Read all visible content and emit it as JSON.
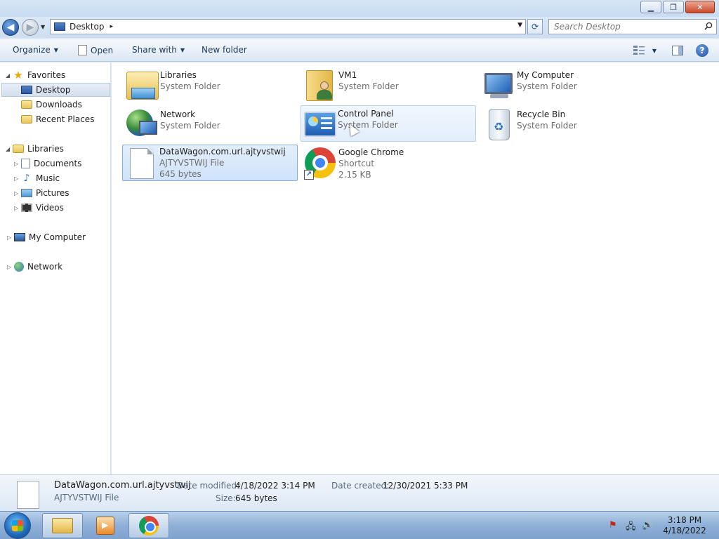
{
  "window": {
    "caption_buttons": {
      "minimize": "▁",
      "maximize": "❐",
      "close": "✕"
    }
  },
  "address": {
    "location": "Desktop",
    "separator": "▸",
    "search_placeholder": "Search Desktop"
  },
  "toolbar": {
    "organize_label": "Organize",
    "open_label": "Open",
    "share_with_label": "Share with",
    "new_folder_label": "New folder"
  },
  "nav": {
    "favorites": {
      "label": "Favorites",
      "items": [
        {
          "label": "Desktop",
          "icon": "desktop-icon",
          "selected": true
        },
        {
          "label": "Downloads",
          "icon": "folder-icon"
        },
        {
          "label": "Recent Places",
          "icon": "folder-icon"
        }
      ]
    },
    "libraries": {
      "label": "Libraries",
      "items": [
        {
          "label": "Documents",
          "icon": "document-icon"
        },
        {
          "label": "Music",
          "icon": "music-icon"
        },
        {
          "label": "Pictures",
          "icon": "pictures-icon"
        },
        {
          "label": "Videos",
          "icon": "videos-icon"
        }
      ]
    },
    "computer": {
      "label": "My Computer",
      "icon": "computer-icon"
    },
    "network": {
      "label": "Network",
      "icon": "network-icon"
    }
  },
  "items": [
    {
      "name": "Libraries",
      "sub1": "System Folder",
      "icon": "libraries-icon"
    },
    {
      "name": "VM1",
      "sub1": "System Folder",
      "icon": "user-folder-icon"
    },
    {
      "name": "My Computer",
      "sub1": "System Folder",
      "icon": "computer-icon"
    },
    {
      "name": "Network",
      "sub1": "System Folder",
      "icon": "network-icon"
    },
    {
      "name": "Control Panel",
      "sub1": "System Folder",
      "icon": "control-panel-icon",
      "state": "hover"
    },
    {
      "name": "Recycle Bin",
      "sub1": "System Folder",
      "icon": "recycle-bin-icon"
    },
    {
      "name": "DataWagon.com.url.ajtyvstwij",
      "sub1": "AJTYVSTWIJ File",
      "sub2": "645 bytes",
      "icon": "file-icon",
      "state": "selected"
    },
    {
      "name": "Google Chrome",
      "sub1": "Shortcut",
      "sub2": "2.15 KB",
      "icon": "chrome-icon"
    }
  ],
  "details": {
    "name": "DataWagon.com.url.ajtyvstwij",
    "type": "AJTYVSTWIJ File",
    "modified_label": "Date modified:",
    "modified_value": "4/18/2022 3:14 PM",
    "created_label": "Date created:",
    "created_value": "12/30/2021 5:33 PM",
    "size_label": "Size:",
    "size_value": "645 bytes"
  },
  "taskbar": {
    "clock_time": "3:18 PM",
    "clock_date": "4/18/2022",
    "pinned": [
      "windows-explorer-icon",
      "media-player-icon",
      "chrome-icon"
    ]
  }
}
